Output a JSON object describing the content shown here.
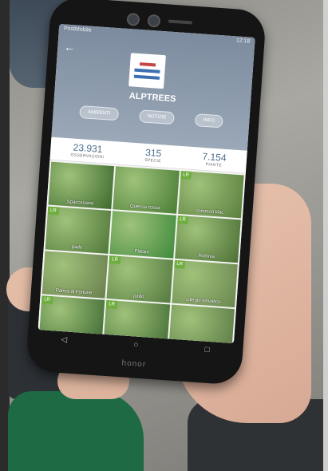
{
  "app": {
    "name": "ALPTREES",
    "status_left": "PostMobile",
    "status_right": "12:18"
  },
  "tabs": [
    "AMBIENTI",
    "NOTIZIE",
    "INFO"
  ],
  "stats": [
    {
      "value": "23.931",
      "label": "OSSERVAZIONI"
    },
    {
      "value": "315",
      "label": "SPECIE"
    },
    {
      "value": "7.154",
      "label": "PIANTE"
    }
  ],
  "tiles": [
    {
      "caption": "Spaccasassi",
      "lr": "",
      "color": "#3e6a2e"
    },
    {
      "caption": "Quercia rossa",
      "lr": "",
      "color": "#4a7d35"
    },
    {
      "caption": "common lilac",
      "lr": "LR",
      "color": "#5a7f3e"
    },
    {
      "caption": "pado",
      "lr": "LR",
      "color": "#50783a"
    },
    {
      "caption": "Platani",
      "lr": "",
      "color": "#3f8a3c"
    },
    {
      "caption": "Robinia",
      "lr": "LR",
      "color": "#4c6f36"
    },
    {
      "caption": "Palma di Fortune",
      "lr": "",
      "color": "#6a7f4e"
    },
    {
      "caption": "pado",
      "lr": "LR",
      "color": "#557a3f"
    },
    {
      "caption": "ciliegio selvatico",
      "lr": "LR",
      "color": "#6b8750"
    },
    {
      "caption": "",
      "lr": "LR",
      "color": "#3f6a33"
    },
    {
      "caption": "",
      "lr": "LR",
      "color": "#466f36"
    },
    {
      "caption": "",
      "lr": "",
      "color": "#5b7a45"
    }
  ],
  "navbar": [
    "◁",
    "○",
    "□"
  ],
  "brand": "honor"
}
